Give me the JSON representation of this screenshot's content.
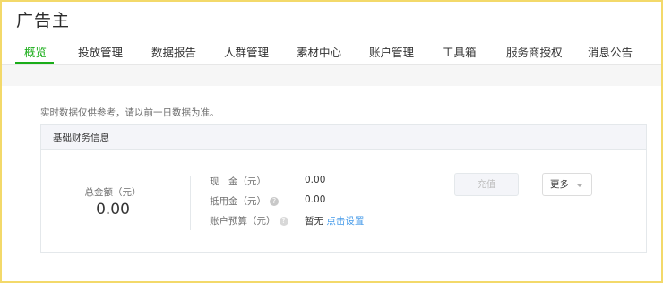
{
  "app": {
    "title": "广告主"
  },
  "tabs": [
    {
      "label": "概览",
      "active": true
    },
    {
      "label": "投放管理"
    },
    {
      "label": "数据报告"
    },
    {
      "label": "人群管理"
    },
    {
      "label": "素材中心"
    },
    {
      "label": "账户管理"
    },
    {
      "label": "工具箱"
    },
    {
      "label": "服务商授权"
    },
    {
      "label": "消息公告"
    }
  ],
  "notice": "实时数据仅供参考，请以前一日数据为准。",
  "finance": {
    "title": "基础财务信息",
    "total_label": "总金额（元）",
    "total_value": "0.00",
    "rows": [
      {
        "label": "现　金（元）",
        "value": "0.00"
      },
      {
        "label": "抵用金（元）",
        "value": "0.00"
      },
      {
        "label": "账户预算（元）",
        "value": "暂无",
        "link": "点击设置"
      }
    ],
    "recharge_label": "充值",
    "more_label": "更多"
  },
  "colors": {
    "accent": "#1aad19",
    "link": "#459ae9",
    "frame": "#f3d96a"
  }
}
